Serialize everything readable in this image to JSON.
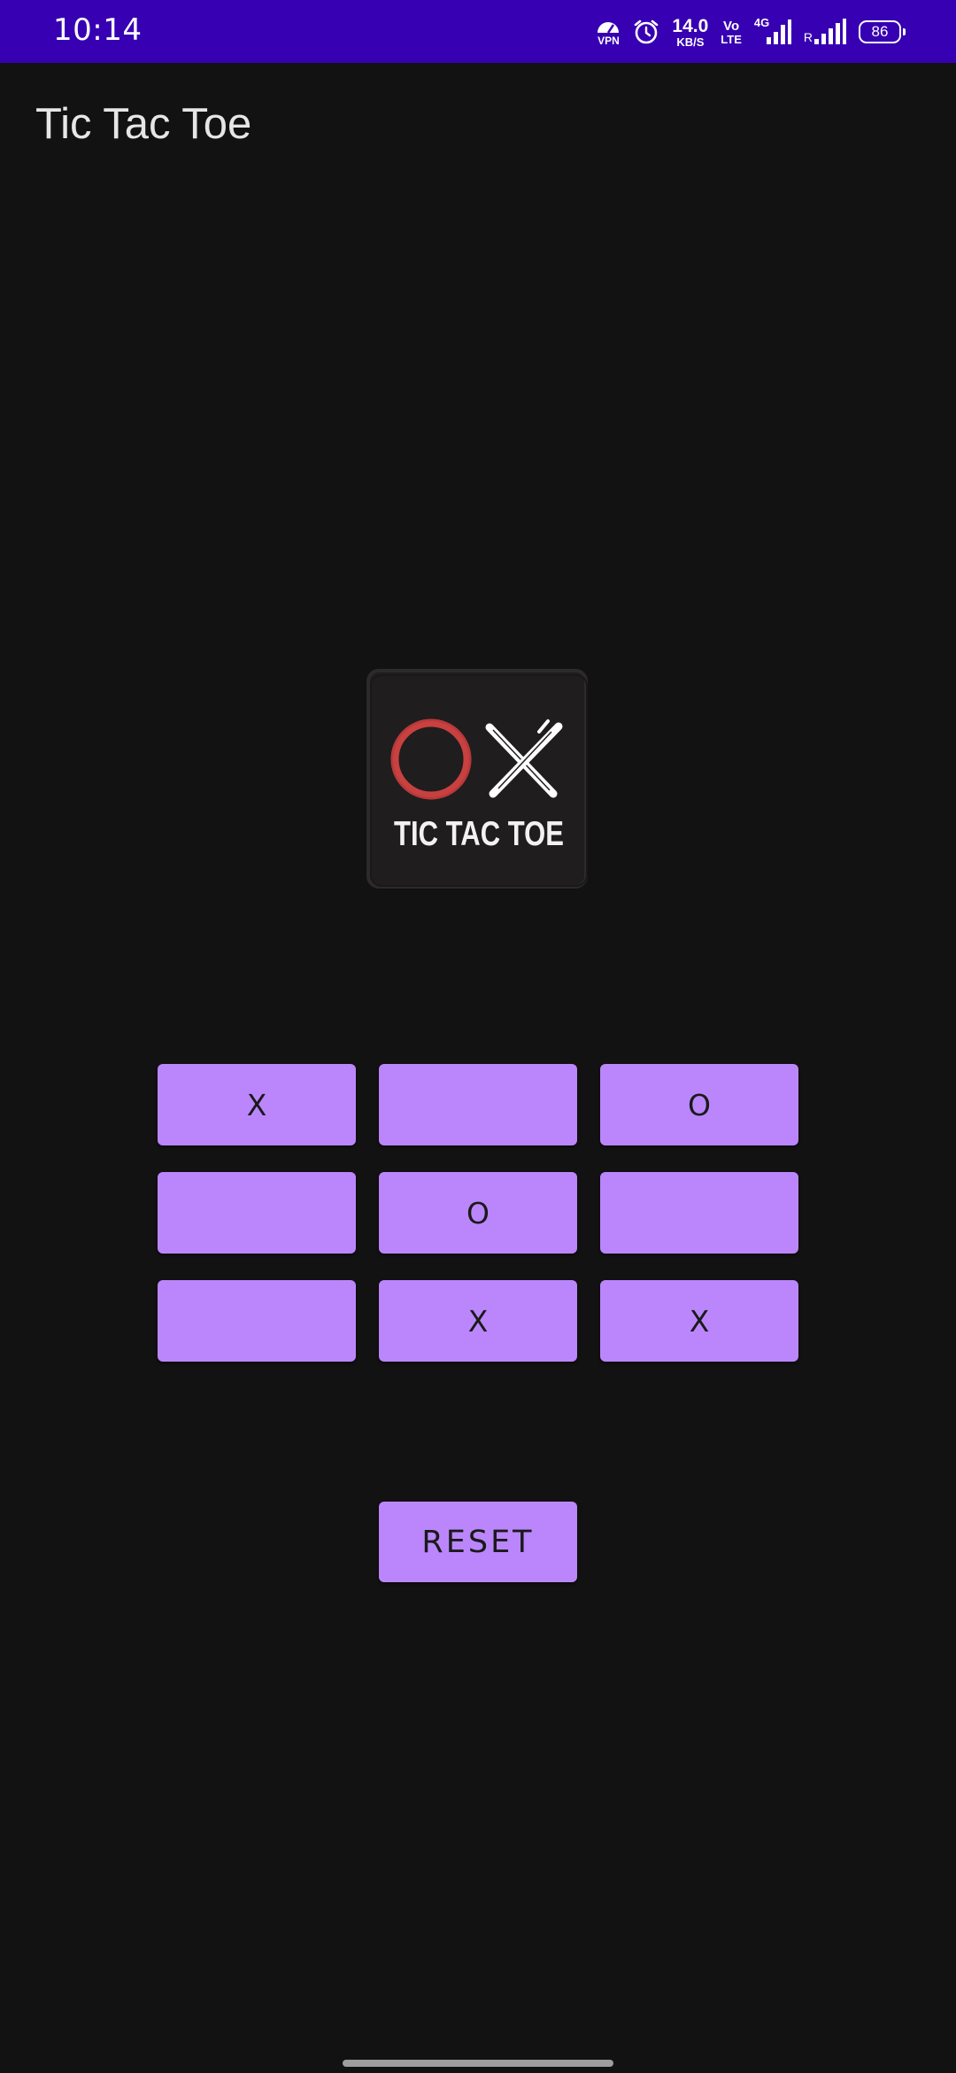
{
  "status_bar": {
    "time": "10:14",
    "vpn_label": "VPN",
    "speed_value": "14.0",
    "speed_unit": "KB/S",
    "volte_top": "Vo",
    "volte_bottom": "LTE",
    "network_type": "4G",
    "roaming": "R",
    "battery": "86",
    "background_color": "#3700b3"
  },
  "app_bar": {
    "title": "Tic Tac Toe"
  },
  "logo": {
    "text": "TIC TAC TOE",
    "o_color": "#c84040",
    "x_color": "#ffffff"
  },
  "board": {
    "cells": [
      "X",
      "",
      "O",
      "",
      "O",
      "",
      "",
      "X",
      "X"
    ],
    "cell_color": "#bb86fc"
  },
  "reset_button": {
    "label": "RESET"
  },
  "colors": {
    "background": "#121212",
    "accent": "#bb86fc"
  }
}
